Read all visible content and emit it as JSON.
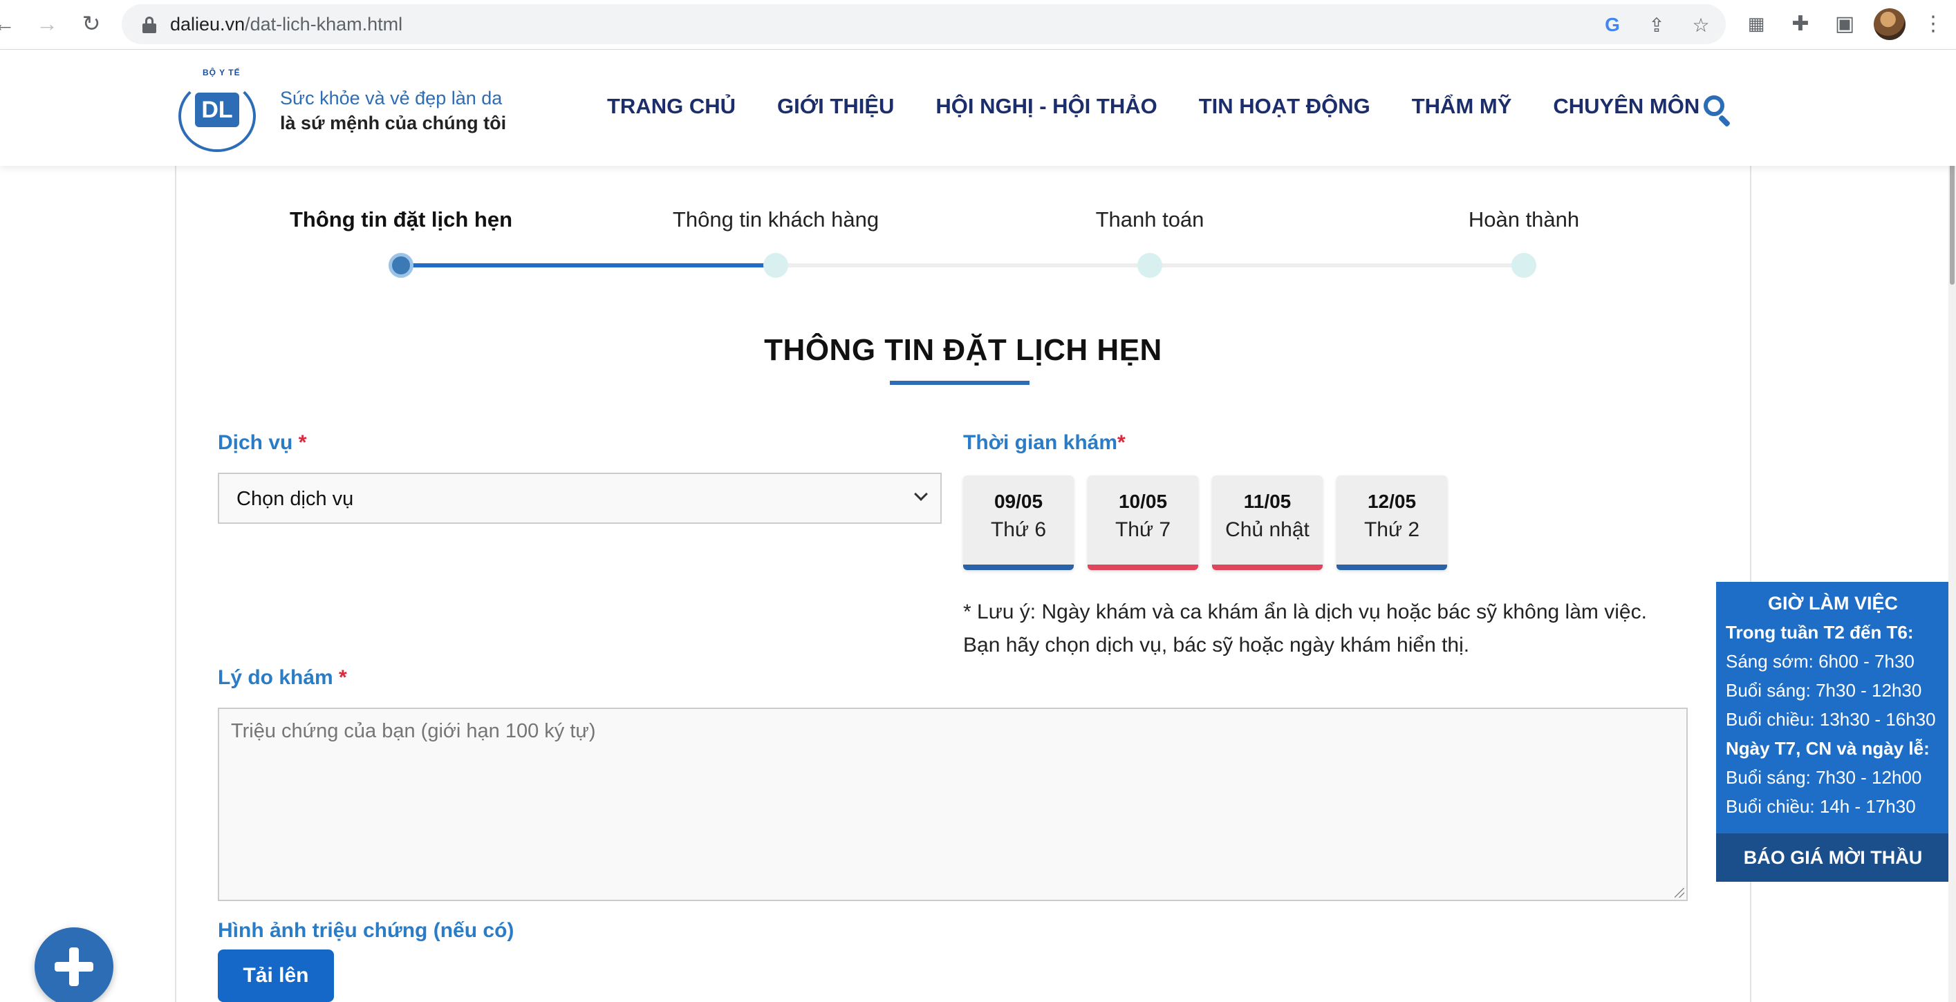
{
  "browser": {
    "url_host": "dalieu.vn",
    "url_path": "/dat-lich-kham.html"
  },
  "header": {
    "logo_top_text": "BỘ Y TẾ",
    "logo_mark": "DL",
    "tagline_line1": "Sức khỏe và vẻ đẹp làn da",
    "tagline_line2": "là sứ mệnh của chúng tôi",
    "nav": [
      "TRANG CHỦ",
      "GIỚI THIỆU",
      "HỘI NGHỊ - HỘI THẢO",
      "TIN HOẠT ĐỘNG",
      "THẨM MỸ",
      "CHUYÊN MÔN"
    ]
  },
  "stepper": {
    "steps": [
      "Thông tin đặt lịch hẹn",
      "Thông tin khách hàng",
      "Thanh toán",
      "Hoàn thành"
    ],
    "active_index": 0,
    "progress_fraction": 0.333,
    "track_color": "#1f6bc5"
  },
  "form": {
    "section_title": "THÔNG TIN ĐẶT LỊCH HẸN",
    "service_label": "Dịch vụ",
    "service_value": "Chọn dịch vụ",
    "time_label": "Thời gian khám",
    "dates": [
      {
        "date": "09/05",
        "weekday": "Thứ 6",
        "bar_color": "#2a62a9"
      },
      {
        "date": "10/05",
        "weekday": "Thứ 7",
        "bar_color": "#e0455c"
      },
      {
        "date": "11/05",
        "weekday": "Chủ nhật",
        "bar_color": "#e0455c"
      },
      {
        "date": "12/05",
        "weekday": "Thứ 2",
        "bar_color": "#2a62a9"
      }
    ],
    "note": "* Lưu ý: Ngày khám và ca khám ẩn là dịch vụ hoặc bác sỹ không làm việc. Bạn hãy chọn dịch vụ, bác sỹ hoặc ngày khám hiển thị.",
    "reason_label": "Lý do khám",
    "reason_placeholder": "Triệu chứng của bạn (giới hạn 100 ký tự)",
    "image_label": "Hình ảnh triệu chứng (nếu có)",
    "upload_label": "Tải lên",
    "required_mark": "*"
  },
  "hours": {
    "title": "GIỜ LÀM VIỆC",
    "weekday_heading": "Trong tuần T2 đến T6:",
    "weekday_early": "Sáng sớm: 6h00 - 7h30",
    "weekday_morning": "Buổi sáng: 7h30 - 12h30",
    "weekday_afternoon": "Buổi chiều: 13h30 - 16h30",
    "weekend_heading": "Ngày T7, CN và ngày lễ:",
    "weekend_morning": "Buổi sáng: 7h30 - 12h00",
    "weekend_afternoon": "Buổi chiều: 14h - 17h30",
    "quote_button": "BÁO GIÁ MỜI THẦU"
  },
  "colors": {
    "brand_blue": "#2d6db5",
    "nav_text": "#1b2d6b",
    "label_blue": "#2a7cc7",
    "required_red": "#e0263b"
  },
  "icons": {
    "back": "arrow-left",
    "forward": "arrow-right",
    "reload": "reload",
    "lock": "lock",
    "google": "google-g",
    "share": "share",
    "bookmark": "star",
    "qr": "qr-code",
    "extensions": "puzzle",
    "sidepanel": "side-panel",
    "menu": "kebab-menu",
    "search": "magnifier",
    "fab": "plus"
  }
}
